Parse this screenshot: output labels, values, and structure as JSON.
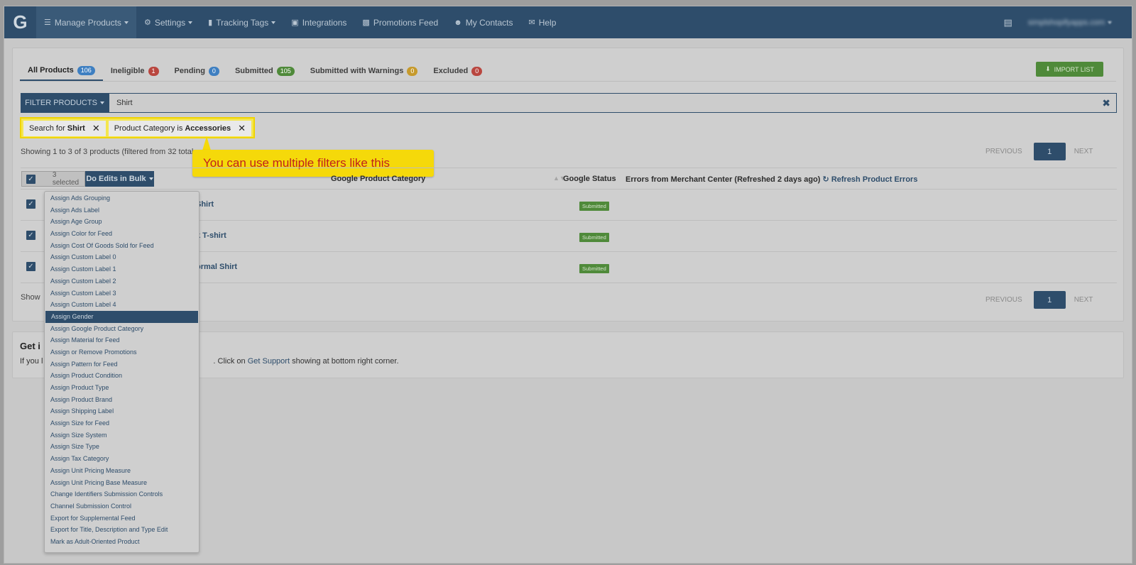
{
  "navbar": {
    "brand": "G",
    "items": [
      {
        "label": "Manage Products",
        "icon": "list-icon",
        "dropdown": true,
        "active": true
      },
      {
        "label": "Settings",
        "icon": "gear-icon",
        "dropdown": true
      },
      {
        "label": "Tracking Tags",
        "icon": "bar-chart-icon",
        "dropdown": true
      },
      {
        "label": "Integrations",
        "icon": "briefcase-icon",
        "dropdown": false
      },
      {
        "label": "Promotions Feed",
        "icon": "clipboard-icon",
        "dropdown": false
      },
      {
        "label": "My Contacts",
        "icon": "contacts-icon",
        "dropdown": false
      },
      {
        "label": "Help",
        "icon": "chat-icon",
        "dropdown": false
      }
    ],
    "account": "simplshopifyapps.com"
  },
  "tabs": [
    {
      "label": "All Products",
      "count": "106",
      "color": "#3e7fc1",
      "active": true
    },
    {
      "label": "Ineligible",
      "count": "1",
      "color": "#b9463f"
    },
    {
      "label": "Pending",
      "count": "0",
      "color": "#3e7fc1"
    },
    {
      "label": "Submitted",
      "count": "105",
      "color": "#4f8a3a"
    },
    {
      "label": "Submitted with Warnings",
      "count": "0",
      "color": "#c69a2c"
    },
    {
      "label": "Excluded",
      "count": "0",
      "color": "#b9463f"
    }
  ],
  "import_button": "IMPORT LIST",
  "filter": {
    "button": "FILTER PRODUCTS",
    "value": "Shirt"
  },
  "chips": [
    {
      "prefix": "Search for",
      "value": "Shirt"
    },
    {
      "prefix": "Product Category is",
      "value": "Accessories"
    }
  ],
  "callout": "You can use multiple filters like this",
  "showing_text": "Showing 1 to 3 of 3 products (filtered from 32 total p",
  "pagination": {
    "previous": "PREVIOUS",
    "page": "1",
    "next": "NEXT"
  },
  "table": {
    "selected_text": "3 selected",
    "bulk_button": "Do Edits in Bulk",
    "col_category": "Google Product Category",
    "col_status": "Google Status",
    "col_errors": "Errors from Merchant Center (Refreshed 2 days ago)",
    "refresh_link": "Refresh Product Errors",
    "rows": [
      {
        "name": "Shirt",
        "status": "Submitted"
      },
      {
        "name": "k T-shirt",
        "status": "Submitted"
      },
      {
        "name": "ormal Shirt",
        "status": "Submitted"
      }
    ],
    "footer_showing": "Show"
  },
  "support": {
    "title": "Get i",
    "text_start": "If you l",
    "text_mid": ". Click on ",
    "link": "Get Support",
    "text_end": " showing at bottom right corner."
  },
  "bulk_menu": {
    "active_index": 10,
    "items": [
      "Assign Ads Grouping",
      "Assign Ads Label",
      "Assign Age Group",
      "Assign Color for Feed",
      "Assign Cost Of Goods Sold for Feed",
      "Assign Custom Label 0",
      "Assign Custom Label 1",
      "Assign Custom Label 2",
      "Assign Custom Label 3",
      "Assign Custom Label 4",
      "Assign Gender",
      "Assign Google Product Category",
      "Assign Material for Feed",
      "Assign or Remove Promotions",
      "Assign Pattern for Feed",
      "Assign Product Condition",
      "Assign Product Type",
      "Assign Product Brand",
      "Assign Shipping Label",
      "Assign Size for Feed",
      "Assign Size System",
      "Assign Size Type",
      "Assign Tax Category",
      "Assign Unit Pricing Measure",
      "Assign Unit Pricing Base Measure",
      "Change Identifiers Submission Controls",
      "Channel Submission Control",
      "Export for Supplemental Feed",
      "Export for Title, Description and Type Edit",
      "Mark as Adult-Oriented Product"
    ]
  }
}
